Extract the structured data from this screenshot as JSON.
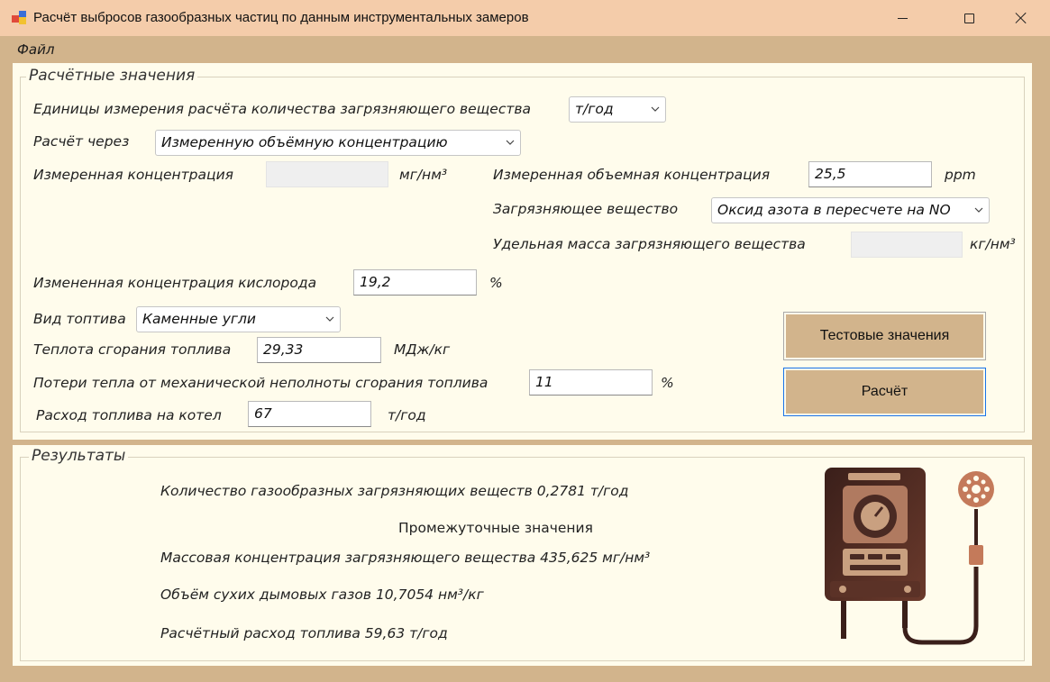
{
  "window": {
    "title": "Расчёт выбросов газообразных частиц по данным инструментальных замеров"
  },
  "menu": {
    "file": "Файл"
  },
  "calc_group": {
    "legend": "Расчётные значения",
    "units_label": "Единицы измерения расчёта количества загрязняющего вещества",
    "units_value": "т/год",
    "calc_via_label": "Расчёт через",
    "calc_via_value": "Измеренную объёмную концентрацию",
    "measured_conc_label": "Измеренная концентрация",
    "measured_conc_value": "",
    "measured_conc_unit": "мг/нм³",
    "vol_conc_label": "Измеренная объемная концентрация",
    "vol_conc_value": "25,5",
    "vol_conc_unit": "ppm",
    "pollutant_label": "Загрязняющее вещество",
    "pollutant_value": "Оксид азота в пересчете на NO",
    "specific_mass_label": "Удельная масса загрязняющего вещества",
    "specific_mass_value": "",
    "specific_mass_unit": "кг/нм³",
    "oxygen_label": "Измененная концентрация кислорода",
    "oxygen_value": "19,2",
    "oxygen_unit": "%",
    "fuel_type_label": "Вид топтива",
    "fuel_type_value": "Каменные угли",
    "heat_label": "Теплота сгорания топлива",
    "heat_value": "29,33",
    "heat_unit": "МДж/кг",
    "losses_label": "Потери тепла от механической неполноты сгорания топлива",
    "losses_value": "11",
    "losses_unit": "%",
    "consumption_label": "Расход топлива на котел",
    "consumption_value": "67",
    "consumption_unit": "т/год",
    "test_button": "Тестовые значения",
    "calc_button": "Расчёт"
  },
  "results_group": {
    "legend": "Результаты",
    "amount": "Количество газообразных загрязняющих веществ  0,2781 т/год",
    "intermediate_title": "Промежуточные значения",
    "mass_conc": "Массовая концентрация загрязняющего вещества  435,625 мг/нм³",
    "dry_gas": "Объём сухих дымовых газов  10,7054 нм³/кг",
    "fuel_rate": "Расчётный расход топлива  59,63 т/год"
  },
  "colors": {
    "window_bg": "#d2b48c",
    "titlebar_bg": "#f4ccaa",
    "panel_bg": "#fffcec",
    "button_bg": "#d2b48c",
    "focus_border": "#1a73e8",
    "device_dark": "#4a2a23",
    "device_accent": "#c47a5a"
  },
  "icons": [
    "app-icon",
    "minimize-icon",
    "maximize-icon",
    "close-icon",
    "chevron-down-icon",
    "gas-analyzer-icon"
  ]
}
